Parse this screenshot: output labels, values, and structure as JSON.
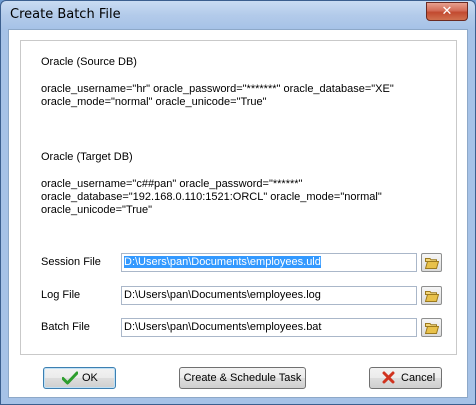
{
  "window": {
    "title": "Create Batch File",
    "close_glyph": "✕"
  },
  "source": {
    "heading": "Oracle (Source DB)",
    "lines": [
      " oracle_username=\"hr\" oracle_password=\"*******\" oracle_database=\"XE\"",
      "oracle_mode=\"normal\" oracle_unicode=\"True\""
    ]
  },
  "target": {
    "heading": "Oracle (Target DB)",
    "lines": [
      " oracle_username=\"c##pan\" oracle_password=\"******\"",
      "oracle_database=\"192.168.0.110:1521:ORCL\" oracle_mode=\"normal\"",
      "oracle_unicode=\"True\""
    ]
  },
  "fields": {
    "session": {
      "label": "Session File",
      "value": "D:\\Users\\pan\\Documents\\employees.uld",
      "selected": true
    },
    "log": {
      "label": "Log File",
      "value": "D:\\Users\\pan\\Documents\\employees.log"
    },
    "batch": {
      "label": "Batch File",
      "value": "D:\\Users\\pan\\Documents\\employees.bat"
    }
  },
  "buttons": {
    "ok": "OK",
    "schedule": "Create & Schedule Task",
    "cancel": "Cancel"
  },
  "colors": {
    "selection": "#3399ff",
    "ok_check": "#2e9e2e",
    "cancel_x": "#d0331f",
    "folder": "#e8c14a"
  },
  "icons": {
    "ok": "checkmark-icon",
    "cancel": "red-x-icon",
    "browse": "folder-open-icon"
  }
}
